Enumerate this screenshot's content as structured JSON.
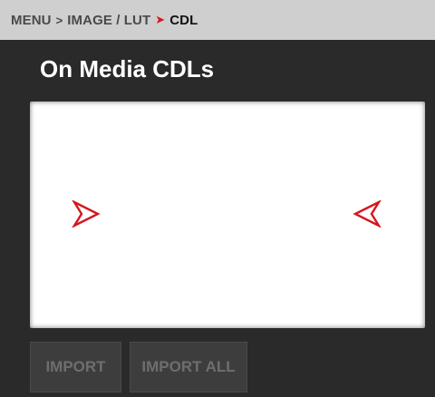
{
  "breadcrumb": {
    "items": [
      "MENU",
      "IMAGE / LUT"
    ],
    "current": "CDL",
    "separator": ">",
    "active_separator": "➤",
    "active_color": "#d6161d"
  },
  "page": {
    "title": "On Media CDLs"
  },
  "cdl_list": {
    "items": [],
    "left_arrow_icon": "triangle-right-outline-icon",
    "right_arrow_icon": "triangle-left-outline-icon"
  },
  "actions": {
    "import_label": "IMPORT",
    "import_all_label": "IMPORT ALL",
    "enabled": false
  }
}
